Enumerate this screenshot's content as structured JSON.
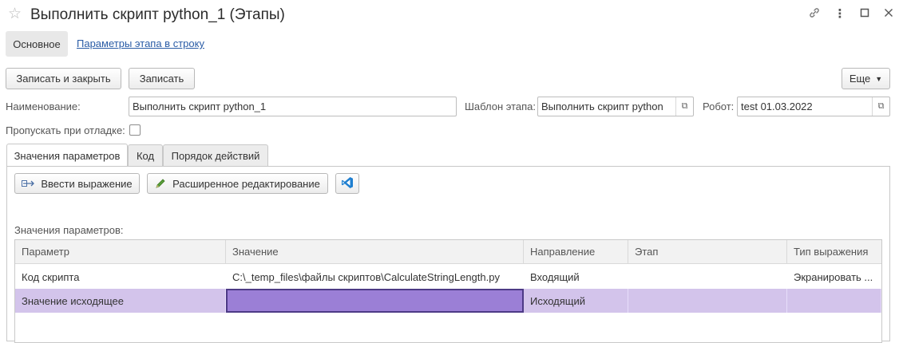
{
  "window": {
    "title": "Выполнить скрипт python_1 (Этапы)"
  },
  "nav": {
    "main_label": "Основное",
    "params_link": "Параметры этапа в строку"
  },
  "toolbar": {
    "save_close_label": "Записать и закрыть",
    "save_label": "Записать",
    "more_label": "Еще"
  },
  "form": {
    "name_label": "Наименование:",
    "name_value": "Выполнить скрипт python_1",
    "template_label": "Шаблон этапа:",
    "template_value": "Выполнить скрипт python",
    "robot_label": "Робот:",
    "robot_value": "test 01.03.2022",
    "skip_debug_label": "Пропускать при отладке:",
    "skip_debug_checked": false
  },
  "tabs": [
    {
      "label": "Значения параметров"
    },
    {
      "label": "Код"
    },
    {
      "label": "Порядок действий"
    }
  ],
  "params_toolbar": {
    "enter_expression_label": "Ввести выражение",
    "advanced_edit_label": "Расширенное редактирование"
  },
  "params_section": {
    "title": "Значения параметров:",
    "columns": [
      "Параметр",
      "Значение",
      "Направление",
      "Этап",
      "Тип выражения"
    ],
    "rows": [
      [
        "Код скрипта",
        "C:\\_temp_files\\файлы скриптов\\CalculateStringLength.py",
        "Входящий",
        "",
        "Экранировать ..."
      ],
      [
        "Значение исходящее",
        "",
        "Исходящий",
        "",
        ""
      ]
    ]
  },
  "colors": {
    "selected_row": "#d3c4eb",
    "editing_cell": "#9b7fd6",
    "link": "#2a5ca6"
  }
}
